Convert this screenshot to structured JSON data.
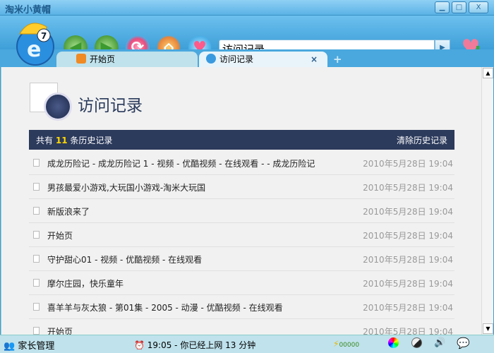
{
  "window": {
    "title": "淘米小黄帽"
  },
  "toolbar": {
    "address": "访问记录"
  },
  "tabs": [
    {
      "label": "开始页"
    },
    {
      "label": "访问记录",
      "close": "×"
    }
  ],
  "tab_add": "+",
  "page": {
    "title": "访问记录",
    "count_prefix": "共有",
    "count": "11",
    "count_suffix": "条历史记录",
    "clear": "清除历史记录",
    "count_color": "#ffd800"
  },
  "history": [
    {
      "title": "成龙历险记 - 成龙历险记 1 - 视频 - 优酷视频 - 在线观看 - - 成龙历险记",
      "date": "2010年5月28日  19:04"
    },
    {
      "title": "男孩最爱小游戏,大玩国小游戏-淘米大玩国",
      "date": "2010年5月28日  19:04"
    },
    {
      "title": "新版浪来了",
      "date": "2010年5月28日  19:04"
    },
    {
      "title": "开始页",
      "date": "2010年5月28日  19:04"
    },
    {
      "title": "守护甜心01 - 视频 - 优酷视频 - 在线观看",
      "date": "2010年5月28日  19:04"
    },
    {
      "title": "摩尔庄园，快乐童年",
      "date": "2010年5月28日  19:04"
    },
    {
      "title": "喜羊羊与灰太狼 - 第01集 - 2005 - 动漫 - 优酷视频 - 在线观看",
      "date": "2010年5月28日  19:04"
    },
    {
      "title": "开始页",
      "date": "2010年5月28日  19:04"
    }
  ],
  "status": {
    "parent": "家长管理",
    "time": "19:05 - 你已经上网 13 分钟",
    "battery": "00000"
  }
}
